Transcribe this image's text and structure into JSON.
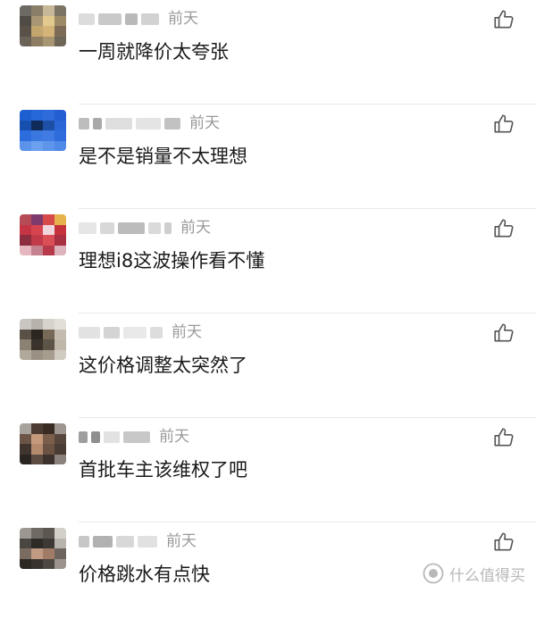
{
  "comments": [
    {
      "name_masked": "▇▇▇▇",
      "time": "前天",
      "text": "一周就降价太夸张"
    },
    {
      "name_masked": "▇▇▇▇",
      "time": "前天",
      "text": "是不是销量不太理想"
    },
    {
      "name_masked": "▇▇▇▇",
      "time": "前天",
      "text": "理想i8这波操作看不懂"
    },
    {
      "name_masked": "▇▇▇▇",
      "time": "前天",
      "text": "这价格调整太突然了"
    },
    {
      "name_masked": "▇▇▇▇",
      "time": "前天",
      "text": "首批车主该维权了吧"
    },
    {
      "name_masked": "▇▇▇▇",
      "time": "前天",
      "text": "价格跳水有点快"
    }
  ],
  "icons": {
    "like": "thumbs-up-icon"
  },
  "watermark": {
    "text": "什么值得买"
  },
  "colors": {
    "time": "#9a9a9a",
    "divider": "#e9e9e9"
  }
}
